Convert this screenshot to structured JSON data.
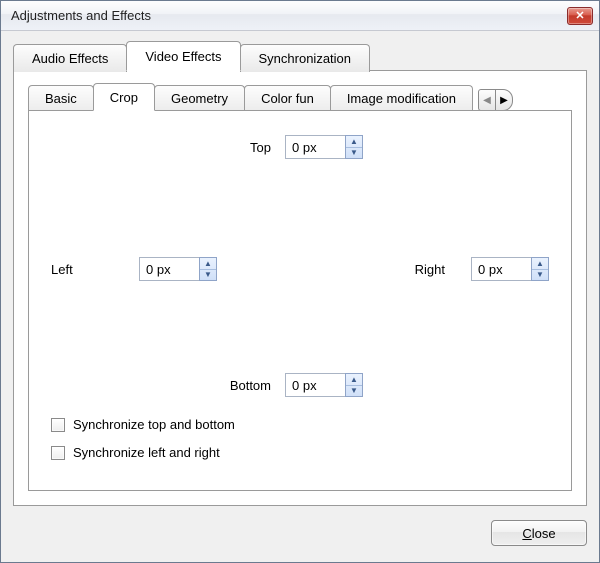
{
  "window": {
    "title": "Adjustments and Effects",
    "close_icon": "✕"
  },
  "outer_tabs": {
    "audio": "Audio Effects",
    "video": "Video Effects",
    "sync": "Synchronization",
    "active": "video"
  },
  "inner_tabs": {
    "basic": "Basic",
    "crop": "Crop",
    "geometry": "Geometry",
    "colorfun": "Color fun",
    "imagemod": "Image modification",
    "active": "crop",
    "scroll_left": "◀",
    "scroll_right": "▶"
  },
  "crop": {
    "top_label": "Top",
    "top_value": "0 px",
    "left_label": "Left",
    "left_value": "0 px",
    "right_label": "Right",
    "right_value": "0 px",
    "bottom_label": "Bottom",
    "bottom_value": "0 px",
    "sync_tb": "Synchronize top and bottom",
    "sync_lr": "Synchronize left and right"
  },
  "spin": {
    "up": "▲",
    "down": "▼"
  },
  "footer": {
    "close_prefix": "C",
    "close_rest": "lose"
  }
}
